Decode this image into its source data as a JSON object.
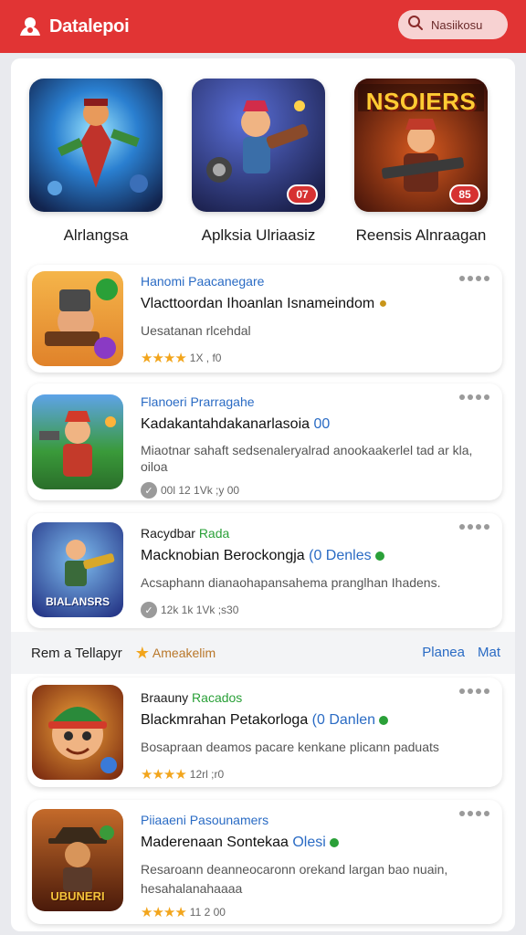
{
  "header": {
    "app_name": "Datalepoi",
    "search_placeholder": "Nasiikosu"
  },
  "featured": [
    {
      "label": "Alrlangsa",
      "badge": ""
    },
    {
      "label": "Aplksia Ulriaasiz",
      "badge": "07"
    },
    {
      "label": "Reensis Alnraagan",
      "badge": "85"
    }
  ],
  "featured_banner_text": "NSOIERS",
  "list_top": [
    {
      "subtitle": "Hanomi Paacanegare",
      "title": "Vlacttoordan Ihoanlan Isnameindom",
      "desc": "Uesatanan rlcehdal",
      "rating_text": "1X , f0"
    },
    {
      "subtitle": "Flanoeri Prarragahe",
      "title": "Kadakantahdakanarlasoia",
      "title_tag": "00",
      "desc": "Miaotnar sahaft sedsenaleryalrad anookaakerlel tad ar kla, oiloa",
      "rating_text": "00l 12 1Vk ;y 00"
    },
    {
      "subtitle": "Racydbar",
      "subtitle_tag": "Rada",
      "title": "Macknobian Berockongja",
      "title_tag": "(0 Denles",
      "desc": "Acsaphann dianaohapansahema pranglhan Ihadens.",
      "rating_text": "12k 1k 1Vk ;s30"
    }
  ],
  "icon_text_card3": "BIALANSRS",
  "section": {
    "title": "Rem a Tellapyr",
    "tag": "Ameakelim",
    "action1": "Planea",
    "action2": "Mat"
  },
  "list_bottom": [
    {
      "subtitle": "Braauny",
      "subtitle_tag": "Racados",
      "title": "Blackmrahan Petakorloga",
      "title_tag": "(0 Danlen",
      "desc": "Bosapraan deamos pacare kenkane plicann paduats",
      "rating_text": "12rl ;r0"
    },
    {
      "subtitle": "Piiaaeni Pasounamers",
      "title": "Maderenaan Sontekaa",
      "title_tag": "Olesi",
      "desc": "Resaroann deanneocaronn orekand largan bao nuain, hesahalanahaaaa",
      "rating_text": "11 2 00"
    }
  ],
  "icon_text_card5": "UBUNERI",
  "colors": {
    "brand_red": "#e13434",
    "link_blue": "#2a6bc4",
    "star_gold": "#f2a51c",
    "verified_green": "#2aa038"
  }
}
